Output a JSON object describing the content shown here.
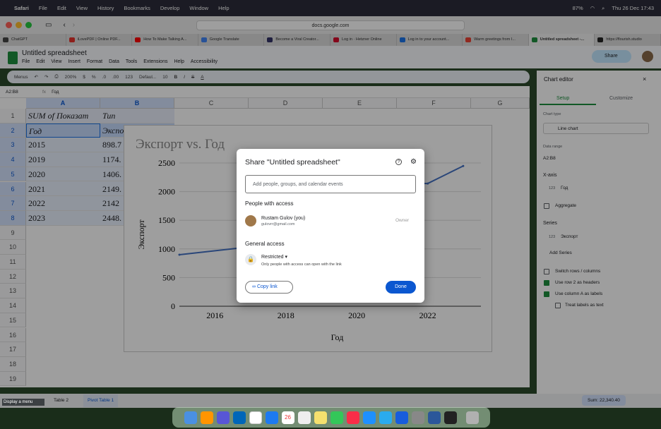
{
  "menubar": {
    "app": "Safari",
    "items": [
      "File",
      "Edit",
      "View",
      "History",
      "Bookmarks",
      "Develop",
      "Window",
      "Help"
    ],
    "battery": "87%",
    "datetime": "Thu 26 Dec 17:43"
  },
  "browser": {
    "url": "docs.google.com",
    "tabs": [
      {
        "label": "ChatGPT",
        "color": "#444"
      },
      {
        "label": "iLovePDF | Online PDF...",
        "color": "#e5322d"
      },
      {
        "label": "How To Make Talking A...",
        "color": "#ff0000"
      },
      {
        "label": "Google Translate",
        "color": "#4285f4"
      },
      {
        "label": "Become a Viral Creator...",
        "color": "#336"
      },
      {
        "label": "Log in · Hetzner Online",
        "color": "#d50c2d"
      },
      {
        "label": "Log in to your account...",
        "color": "#1a73e8"
      },
      {
        "label": "Warm greetings from I...",
        "color": "#ea4335"
      },
      {
        "label": "Untitled spreadsheet -...",
        "color": "#1e8e3e",
        "active": true
      },
      {
        "label": "https://flourish.studio",
        "color": "#222"
      }
    ]
  },
  "doc": {
    "title": "Untitled spreadsheet",
    "menus": [
      "File",
      "Edit",
      "View",
      "Insert",
      "Format",
      "Data",
      "Tools",
      "Extensions",
      "Help",
      "Accessibility"
    ],
    "share_label": "Share"
  },
  "toolbar": {
    "search": "Menus",
    "zoom": "200%",
    "currency": "$",
    "percent": "%",
    "dec_dec": ".0",
    "dec_inc": ".00",
    "number": "123",
    "font": "Defaul...",
    "font_size": "10"
  },
  "formula": {
    "cell_ref": "A2:B8",
    "fx": "fx",
    "content": "Год"
  },
  "grid": {
    "columns": [
      "A",
      "B",
      "C",
      "D",
      "E",
      "F",
      "G"
    ],
    "rows": [
      "1",
      "2",
      "3",
      "4",
      "5",
      "6",
      "7",
      "8",
      "9",
      "10",
      "11",
      "12",
      "13",
      "14",
      "15",
      "16",
      "17",
      "18",
      "19"
    ],
    "a1": "SUM of Показат",
    "b1": "Тип",
    "header_a": "Год",
    "header_b": "Экспо",
    "data": [
      [
        "2015",
        "898.7"
      ],
      [
        "2019",
        "1174."
      ],
      [
        "2020",
        "1406."
      ],
      [
        "2021",
        "2149."
      ],
      [
        "2022",
        "2142"
      ],
      [
        "2023",
        "2448."
      ]
    ]
  },
  "chart_data": {
    "type": "line",
    "title": "Экспорт vs. Год",
    "xlabel": "Год",
    "ylabel": "Экспорт",
    "x": [
      2015,
      2019,
      2020,
      2021,
      2022,
      2023
    ],
    "series": [
      {
        "values": [
          898.7,
          1174,
          1406,
          2149,
          2142,
          2448
        ]
      }
    ],
    "xticks": [
      "2016",
      "2018",
      "2020",
      "2022"
    ],
    "yticks": [
      "0",
      "500",
      "1000",
      "1500",
      "2000",
      "2500"
    ],
    "xlim": [
      2015,
      2023.5
    ],
    "ylim": [
      0,
      2500
    ],
    "line_color": "#4472c4"
  },
  "editor": {
    "title": "Chart editor",
    "tab_setup": "Setup",
    "tab_customize": "Customize",
    "chart_type_label": "Chart type",
    "chart_type": "Line chart",
    "data_range_label": "Data range",
    "data_range": "A2:B8",
    "xaxis_label": "X-axis",
    "xaxis_value": "Год",
    "xaxis_prefix": "123",
    "aggregate": "Aggregate",
    "series_label": "Series",
    "series_value": "Экспорт",
    "series_prefix": "123",
    "add_series": "Add Series",
    "switch_rows": "Switch rows / columns",
    "use_row2": "Use row 2 as headers",
    "use_colA": "Use column A as labels",
    "treat_labels": "Treat labels as text"
  },
  "sheets": {
    "tab1": "Table 2",
    "tab2": "Pivot Table 1",
    "sum": "Sum: 22,340.40"
  },
  "tooltip": "Display a menu",
  "dialog": {
    "title": "Share \"Untitled spreadsheet\"",
    "input_placeholder": "Add people, groups, and calendar events",
    "people_heading": "People with access",
    "user_name": "Rustam Gulov (you)",
    "user_email": "gulovrr@gmail.com",
    "user_role": "Owner",
    "general_heading": "General access",
    "access_level": "Restricted",
    "access_desc": "Only people with access can open with the link",
    "copy_link": "Copy link",
    "done": "Done"
  },
  "dock": {
    "calendar_day": "26"
  }
}
